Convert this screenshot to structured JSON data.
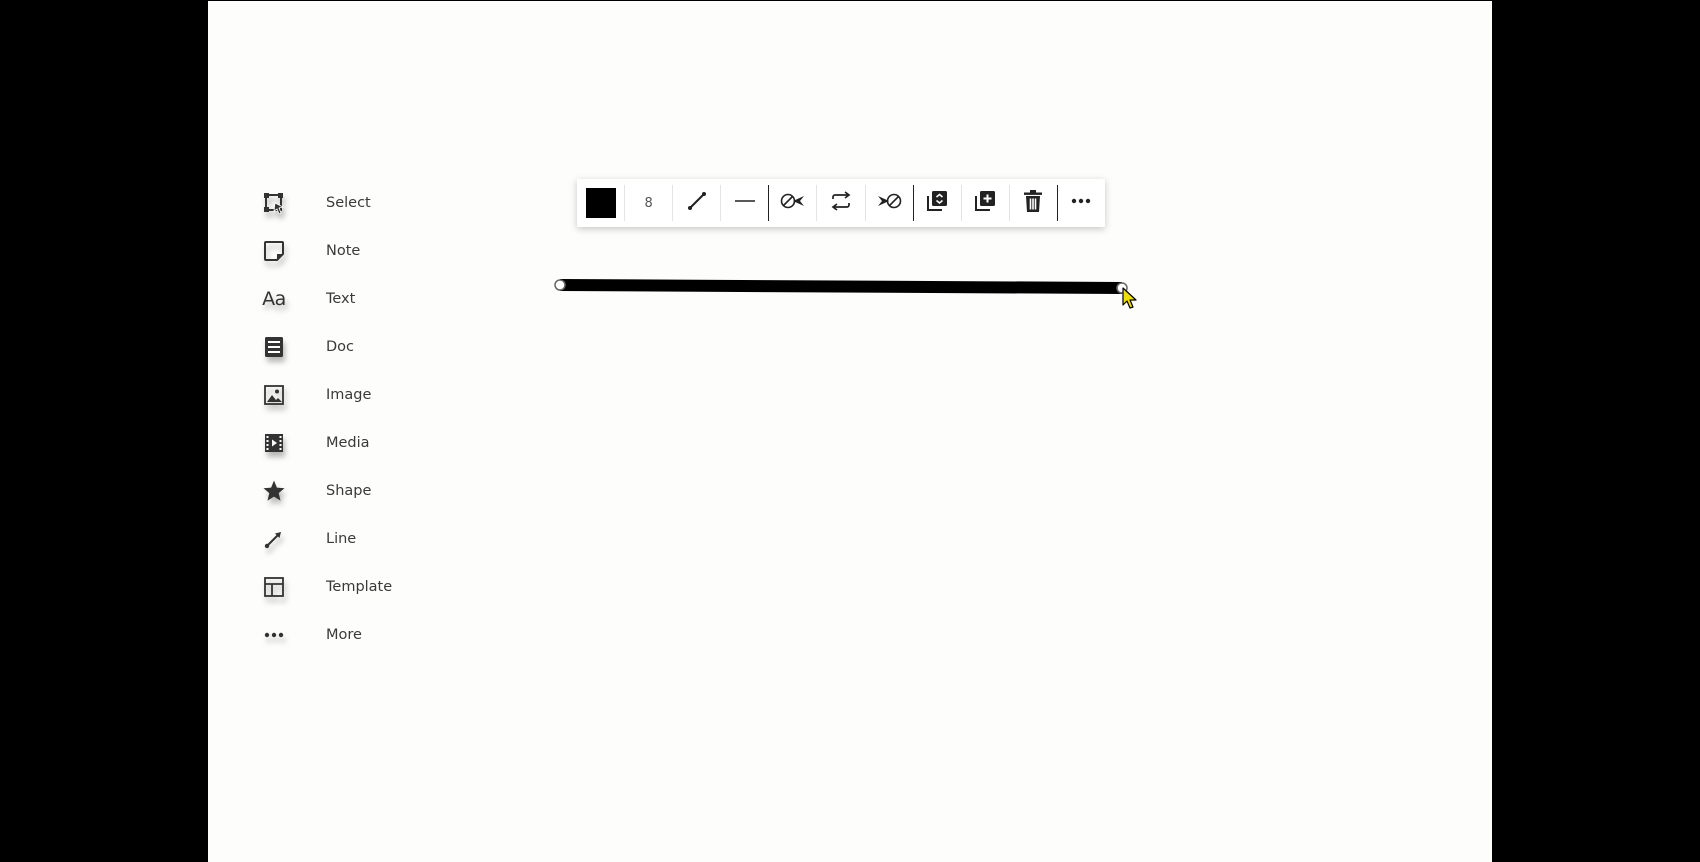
{
  "tool_palette": {
    "items": [
      {
        "label": "Select"
      },
      {
        "label": "Note"
      },
      {
        "label": "Text",
        "icon_text": "Aa"
      },
      {
        "label": "Doc"
      },
      {
        "label": "Image"
      },
      {
        "label": "Media"
      },
      {
        "label": "Shape"
      },
      {
        "label": "Line"
      },
      {
        "label": "Template"
      },
      {
        "label": "More"
      }
    ]
  },
  "toolbar": {
    "line_color": "#000000",
    "line_width": "8",
    "buttons": [
      "color-swatch",
      "line-width",
      "line-style-diagonal-icon",
      "line-style-straight-icon",
      "start-arrow-icon",
      "swap-direction-icon",
      "end-arrow-icon",
      "arrange-layer-icon",
      "duplicate-icon",
      "delete-icon",
      "more-options-icon"
    ]
  },
  "canvas": {
    "background": "#fdfdfb",
    "line_color": "#000000",
    "handle_color": "#ffffff"
  }
}
